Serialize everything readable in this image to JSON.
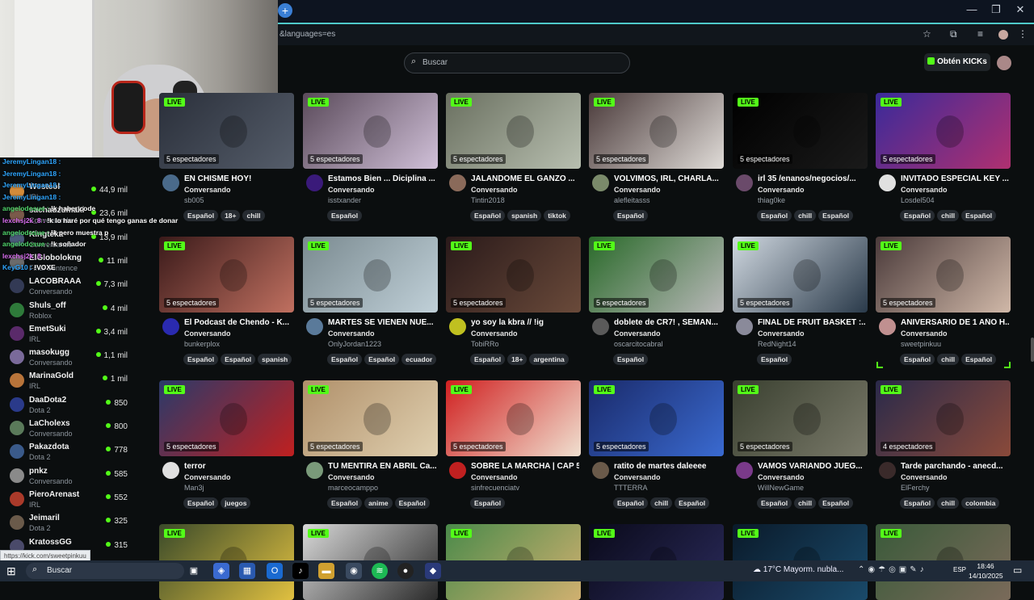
{
  "browser": {
    "url_fragment": "&languages=es",
    "new_tab_symbol": "+"
  },
  "header": {
    "search_placeholder": "Buscar",
    "get_kicks_label": "Obtén KICKs"
  },
  "sidebar": {
    "channels": [
      {
        "name": "Westcol",
        "category": "IRL",
        "viewers": "44,9 mil",
        "color": "#d28b3a"
      },
      {
        "name": "sachauzumaki",
        "category": "Conversando",
        "viewers": "23,6 mil",
        "color": "#7a5a4a"
      },
      {
        "name": "Kingteka",
        "category": "Conversando",
        "viewers": "13,9 mil",
        "color": "#4a5a7a"
      },
      {
        "name": "ElGlobolokng",
        "category": "Final Sentence",
        "viewers": "11 mil",
        "color": "#6b6b6b"
      },
      {
        "name": "LACOBRAAA",
        "category": "Conversando",
        "viewers": "7,3 mil",
        "color": "#333a55"
      },
      {
        "name": "Shuls_off",
        "category": "Roblox",
        "viewers": "4 mil",
        "color": "#2e7a3a"
      },
      {
        "name": "EmetSuki",
        "category": "IRL",
        "viewers": "3,4 mil",
        "color": "#5a2a6a"
      },
      {
        "name": "masokugg",
        "category": "Conversando",
        "viewers": "1,1 mil",
        "color": "#7a6a9a"
      },
      {
        "name": "MarinaGold",
        "category": "IRL",
        "viewers": "1 mil",
        "color": "#b8743a"
      },
      {
        "name": "DaaDota2",
        "category": "Dota 2",
        "viewers": "850",
        "color": "#2a3a8a"
      },
      {
        "name": "LaCholexs",
        "category": "Conversando",
        "viewers": "800",
        "color": "#5a7a5a"
      },
      {
        "name": "Pakazdota",
        "category": "Dota 2",
        "viewers": "778",
        "color": "#3a5a8a"
      },
      {
        "name": "pnkz",
        "category": "Conversando",
        "viewers": "585",
        "color": "#8a8a8a"
      },
      {
        "name": "PieroArenast",
        "category": "IRL",
        "viewers": "552",
        "color": "#aa3a2a"
      },
      {
        "name": "Jeimaril",
        "category": "Dota 2",
        "viewers": "325",
        "color": "#6a5a4a"
      },
      {
        "name": "KratossGG",
        "category": "",
        "viewers": "315",
        "color": "#4a4a6a"
      }
    ]
  },
  "chat_overlay": [
    {
      "user": "JeremyLingan18 :",
      "text": "",
      "kind": 1
    },
    {
      "user": "JeremyLingan18 :",
      "text": "",
      "kind": 1
    },
    {
      "user": "JeremyLingan18 :",
      "text": "",
      "kind": 1
    },
    {
      "user": "JeremyLingan18 :",
      "text": "",
      "kind": 1
    },
    {
      "user": "angelodosue :",
      "text": "!k haber code",
      "kind": 2
    },
    {
      "user": "lexchsj2k_8 :",
      "text": "!k lo haré por qué tengo ganas de donar",
      "kind": 3
    },
    {
      "user": "angelodosue :",
      "text": "!k pero muestra p",
      "kind": 2
    },
    {
      "user": "angelodosue :",
      "text": "!k soñador",
      "kind": 2
    },
    {
      "user": "lexchsj2k_8 :",
      "text": "",
      "kind": 3
    },
    {
      "user": "KeyG10 :",
      "text": "!VOXE",
      "kind": 1
    }
  ],
  "status_url": "https://kick.com/sweetpinkuu",
  "streams": [
    {
      "title": "EN CHISME HOY!",
      "category": "Conversando",
      "user": "sb005",
      "viewers": "5 espectadores",
      "tags": [
        "Español",
        "18+",
        "chill"
      ],
      "bg": [
        "#2a2f3a",
        "#555d6a"
      ],
      "avatar": "#4a6a8a"
    },
    {
      "title": "Estamos Bien ... Diciplina ...",
      "category": "Conversando",
      "user": "isstxander",
      "viewers": "5 espectadores",
      "tags": [
        "Español"
      ],
      "bg": [
        "#5a4a5a",
        "#d0c0d8"
      ],
      "avatar": "#3a1a7a"
    },
    {
      "title": "JALANDOME EL GANZO ...",
      "category": "Conversando",
      "user": "Tintin2018",
      "viewers": "5 espectadores",
      "tags": [
        "Español",
        "spanish",
        "tiktok"
      ],
      "bg": [
        "#6a7060",
        "#b8bfb0"
      ],
      "avatar": "#8a6a5a"
    },
    {
      "title": "VOLVIMOS, IRL, CHARLA...",
      "category": "Conversando",
      "user": "alefleitasss",
      "viewers": "5 espectadores",
      "tags": [
        "Español"
      ],
      "bg": [
        "#4a3a3a",
        "#e0dcd8"
      ],
      "avatar": "#7a8a6a"
    },
    {
      "title": "irl 35 /enanos/negocios/...",
      "category": "Conversando",
      "user": "thiag0ke",
      "viewers": "5 espectadores",
      "tags": [
        "Español",
        "chill",
        "Español"
      ],
      "bg": [
        "#000000",
        "#1a1a1a"
      ],
      "avatar": "#6a4a6a"
    },
    {
      "title": "INVITADO ESPECIAL KEY ...",
      "category": "Conversando",
      "user": "Losdel504",
      "viewers": "5 espectadores",
      "tags": [
        "Español",
        "chill",
        "Español"
      ],
      "bg": [
        "#3a2a9a",
        "#b03070"
      ],
      "avatar": "#e0e0e0"
    },
    {
      "title": "El Podcast de Chendo - K...",
      "category": "Conversando",
      "user": "bunkerplox",
      "viewers": "5 espectadores",
      "tags": [
        "Español",
        "Español",
        "spanish"
      ],
      "bg": [
        "#3a1a1a",
        "#c07060"
      ],
      "avatar": "#2a2ab0"
    },
    {
      "title": "MARTES SE VIENEN NUE...",
      "category": "Conversando",
      "user": "OnlyJordan1223",
      "viewers": "5 espectadores",
      "tags": [
        "Español",
        "Español",
        "ecuador"
      ],
      "bg": [
        "#7a8a90",
        "#c0d0d8"
      ],
      "avatar": "#5a7a9a"
    },
    {
      "title": "yo soy la kbra // !ig",
      "category": "Conversando",
      "user": "TobiRRo",
      "viewers": "5 espectadores",
      "tags": [
        "Español",
        "18+",
        "argentina"
      ],
      "bg": [
        "#2a1a1a",
        "#6a4a3a"
      ],
      "avatar": "#c0c020"
    },
    {
      "title": "doblete de CR7! , SEMAN...",
      "category": "Conversando",
      "user": "oscarcitocabral",
      "viewers": "5 espectadores",
      "tags": [
        "Español"
      ],
      "bg": [
        "#2a6a2a",
        "#b8b8b8"
      ],
      "avatar": "#5a5a5a"
    },
    {
      "title": "FINAL DE FRUIT BASKET :...",
      "category": "Conversando",
      "user": "RedNight14",
      "viewers": "5 espectadores",
      "tags": [
        "Español"
      ],
      "bg": [
        "#d0d8e0",
        "#2a3a4a"
      ],
      "avatar": "#8a8a9a"
    },
    {
      "title": "ANIVERSARIO DE 1 AÑO H...",
      "category": "Conversando",
      "user": "sweetpinkuu",
      "viewers": "5 espectadores",
      "tags": [
        "Español",
        "chill",
        "Español"
      ],
      "bg": [
        "#4a3a3a",
        "#d0b8a8"
      ],
      "avatar": "#c09090"
    },
    {
      "title": "terror",
      "category": "Conversando",
      "user": "Man3j",
      "viewers": "5 espectadores",
      "tags": [
        "Español",
        "juegos"
      ],
      "bg": [
        "#2a3a6a",
        "#c02020"
      ],
      "avatar": "#e0e0e0"
    },
    {
      "title": "TU MENTIRA EN ABRIL Ca...",
      "category": "Conversando",
      "user": "marceocamppo",
      "viewers": "5 espectadores",
      "tags": [
        "Español",
        "anime",
        "Español"
      ],
      "bg": [
        "#b0906a",
        "#e0d0b0"
      ],
      "avatar": "#7a9a7a"
    },
    {
      "title": "SOBRE LA MARCHA | CAP 5",
      "category": "Conversando",
      "user": "sinfrecuenciatv",
      "viewers": "5 espectadores",
      "tags": [
        "Español"
      ],
      "bg": [
        "#d02020",
        "#f0e0d0"
      ],
      "avatar": "#c02020"
    },
    {
      "title": "ratito de martes daleeee",
      "category": "Conversando",
      "user": "TTTERRA",
      "viewers": "5 espectadores",
      "tags": [
        "Español",
        "chill",
        "Español"
      ],
      "bg": [
        "#1a2a6a",
        "#3a6ad0"
      ],
      "avatar": "#6a5a4a"
    },
    {
      "title": "VAMOS VARIANDO JUEG...",
      "category": "Conversando",
      "user": "WillNewGame",
      "viewers": "5 espectadores",
      "tags": [
        "Español",
        "chill",
        "Español"
      ],
      "bg": [
        "#3a4030",
        "#7a7a6a"
      ],
      "avatar": "#7a3a8a"
    },
    {
      "title": "Tarde parchando - anecd...",
      "category": "Conversando",
      "user": "ElFerchy",
      "viewers": "4 espectadores",
      "tags": [
        "Español",
        "chill",
        "colombia"
      ],
      "bg": [
        "#2a2a4a",
        "#8a4a3a"
      ],
      "avatar": "#3a2a2a"
    },
    {
      "title": "",
      "category": "",
      "user": "",
      "viewers": "",
      "tags": [],
      "bg": [
        "#3a4a2a",
        "#e0c040"
      ],
      "avatar": ""
    },
    {
      "title": "",
      "category": "",
      "user": "",
      "viewers": "",
      "tags": [],
      "bg": [
        "#d8d8d8",
        "#2a2a2a"
      ],
      "avatar": ""
    },
    {
      "title": "",
      "category": "",
      "user": "",
      "viewers": "",
      "tags": [],
      "bg": [
        "#4a8a4a",
        "#d0b070"
      ],
      "avatar": ""
    },
    {
      "title": "",
      "category": "",
      "user": "",
      "viewers": "",
      "tags": [],
      "bg": [
        "#0a0a1a",
        "#2a2a5a"
      ],
      "avatar": ""
    },
    {
      "title": "",
      "category": "",
      "user": "",
      "viewers": "",
      "tags": [],
      "bg": [
        "#0a1a2a",
        "#1a4a6a"
      ],
      "avatar": ""
    },
    {
      "title": "",
      "category": "",
      "user": "",
      "viewers": "",
      "tags": [],
      "bg": [
        "#3a5a3a",
        "#7a6a5a"
      ],
      "avatar": ""
    }
  ],
  "live_label": "LIVE",
  "taskbar": {
    "search_placeholder": "Buscar",
    "weather": "17°C  Mayorm. nubla...",
    "language": "ESP",
    "time": "18:46",
    "date": "14/10/2025"
  }
}
